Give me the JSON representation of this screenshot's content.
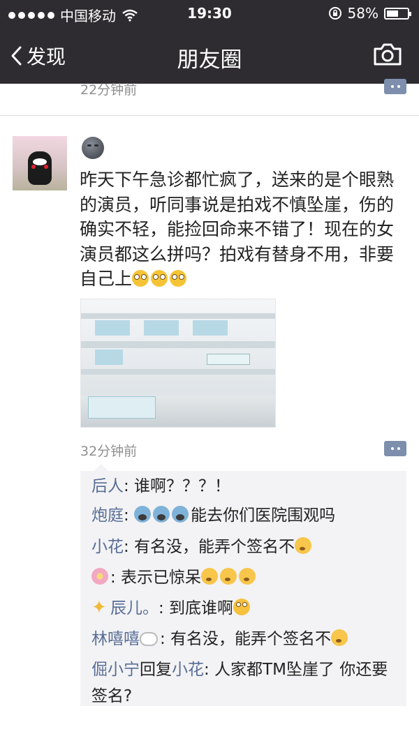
{
  "status_bar": {
    "carrier": "中国移动",
    "time": "19:30",
    "battery_percent": "58%",
    "battery_level": 0.58
  },
  "nav": {
    "back_label": "发现",
    "title": "朋友圈"
  },
  "previous_post": {
    "timestamp": "22分钟前"
  },
  "post": {
    "text": "昨天下午急诊都忙疯了，送来的是个眼熟的演员，听同事说是拍戏不慎坠崖，伤的确实不轻，能捡回命来不错了！现在的女演员都这么拼吗？拍戏有替身不用，非要自己上",
    "timestamp": "32分钟前",
    "comments": [
      {
        "user": "后人",
        "text": ": 谁啊？？？！"
      },
      {
        "user": "炮庭",
        "text": "能去你们医院围观吗"
      },
      {
        "user": "小花",
        "text": ": 有名没，能弄个签名不"
      },
      {
        "text": ": 表示已惊呆"
      },
      {
        "user": "辰儿。",
        "text": ": 到底谁啊"
      },
      {
        "user": "林嘻嘻",
        "text": ": 有名没，能弄个签名不"
      },
      {
        "user": "倔小宁",
        "reply_word": "回复",
        "reply_to": "小花",
        "text": ": 人家都TM坠崖了 你还要签名?"
      }
    ]
  },
  "colors": {
    "nav_background": "#2e2c31",
    "username_link": "#586d95",
    "comment_background": "#f3f3f5",
    "timestamp_gray": "#8f8f8f"
  }
}
